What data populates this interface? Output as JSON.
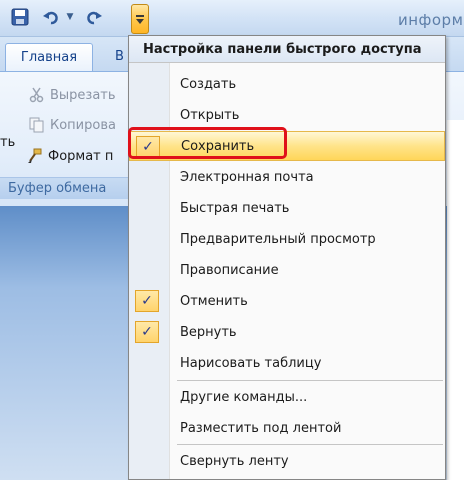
{
  "colors": {
    "menu_highlight": "#ffe48a",
    "check_bg": "#ffd36b",
    "annotation_red": "#e0101a",
    "ribbon_text": "#15428b"
  },
  "title_bar": {
    "document_title_fragment": "информ",
    "buttons": {
      "save_icon": "save-icon",
      "undo_icon": "undo-icon",
      "undo_dropdown_icon": "chevron-down-icon",
      "redo_icon": "redo-icon",
      "customize_icon": "customize-qat-icon"
    }
  },
  "ribbon": {
    "tabs": [
      {
        "label": "Главная",
        "active": true
      },
      {
        "label": "В",
        "active": false
      }
    ],
    "clipboard_group": {
      "cut_label": "Вырезать",
      "copy_label": "Копирова",
      "format_label": "Формат п",
      "paste_label_fragment": "ть",
      "group_label": "Буфер обмена"
    }
  },
  "menu": {
    "header": "Настройка панели быстрого доступа",
    "items": [
      {
        "label": "Создать",
        "checked": false
      },
      {
        "label": "Открыть",
        "checked": false
      },
      {
        "label": "Сохранить",
        "checked": true,
        "highlighted": true
      },
      {
        "label": "Электронная почта",
        "checked": false
      },
      {
        "label": "Быстрая печать",
        "checked": false
      },
      {
        "label": "Предварительный просмотр",
        "checked": false
      },
      {
        "label": "Правописание",
        "checked": false
      },
      {
        "label": "Отменить",
        "checked": true
      },
      {
        "label": "Вернуть",
        "checked": true
      },
      {
        "label": "Нарисовать таблицу",
        "checked": false
      }
    ],
    "extra_items": [
      {
        "label": "Другие команды..."
      },
      {
        "label": "Разместить под лентой"
      },
      {
        "label": "Свернуть ленту"
      }
    ],
    "check_glyph": "✓"
  }
}
